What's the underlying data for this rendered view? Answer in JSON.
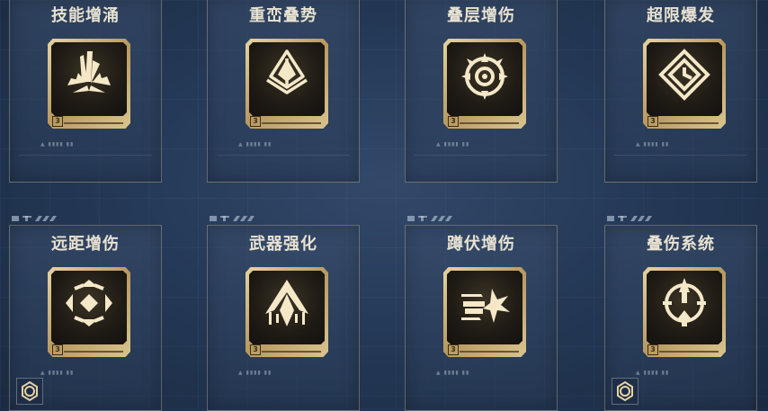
{
  "cards": [
    {
      "title": "技能增涌",
      "icon": "burst-spikes-icon",
      "level": "3"
    },
    {
      "title": "重峦叠势",
      "icon": "mountain-layers-icon",
      "level": "3"
    },
    {
      "title": "叠层增伤",
      "icon": "crosshair-target-icon",
      "level": "3"
    },
    {
      "title": "超限爆发",
      "icon": "diamond-clock-icon",
      "level": "3"
    },
    {
      "title": "远距增伤",
      "icon": "hex-target-icon",
      "level": "3"
    },
    {
      "title": "武器强化",
      "icon": "arrow-blade-icon",
      "level": "3"
    },
    {
      "title": "蹲伏增伤",
      "icon": "bullet-impact-icon",
      "level": "3"
    },
    {
      "title": "叠伤系统",
      "icon": "target-arrow-up-icon",
      "level": "3"
    }
  ],
  "colors": {
    "gold": "#e6d3a2",
    "title": "#e8e2d2",
    "icon": "#f5e8c8"
  }
}
